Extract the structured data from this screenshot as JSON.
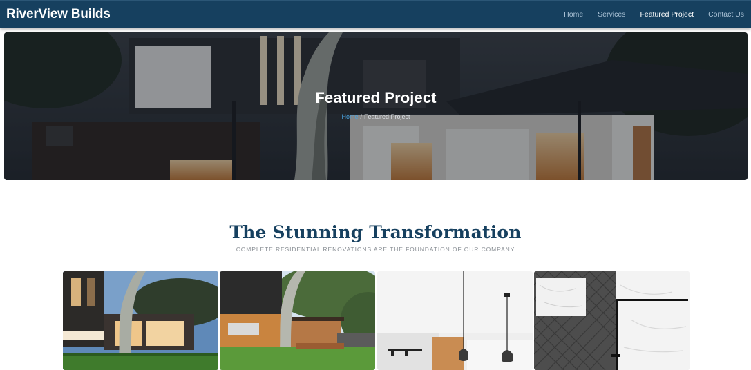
{
  "brand": "RiverView Builds",
  "nav": {
    "items": [
      {
        "label": "Home"
      },
      {
        "label": "Services"
      },
      {
        "label": "Featured Project"
      },
      {
        "label": "Contact Us"
      }
    ],
    "active": "Featured Project"
  },
  "hero": {
    "title": "Featured Project",
    "breadcrumb": {
      "home": "Home",
      "separator": "/",
      "current": "Featured Project"
    }
  },
  "section": {
    "title": "The Stunning Transformation",
    "subtitle": "COMPLETE RESIDENTIAL RENOVATIONS ARE THE FOUNDATION OF OUR COMPANY"
  },
  "gallery": {
    "images": [
      {
        "name": "exterior-dusk-photo"
      },
      {
        "name": "exterior-day-photo"
      },
      {
        "name": "kitchen-pendant-lights-photo"
      },
      {
        "name": "bathroom-tile-photo"
      }
    ]
  },
  "colors": {
    "navbar": "#16405f",
    "brand_text": "#ffffff",
    "link_active": "#ffffff",
    "link_inactive": "#aac2d6",
    "breadcrumb_link": "#4aa3df",
    "heading": "#16405f",
    "subtitle": "#8a8f95"
  }
}
